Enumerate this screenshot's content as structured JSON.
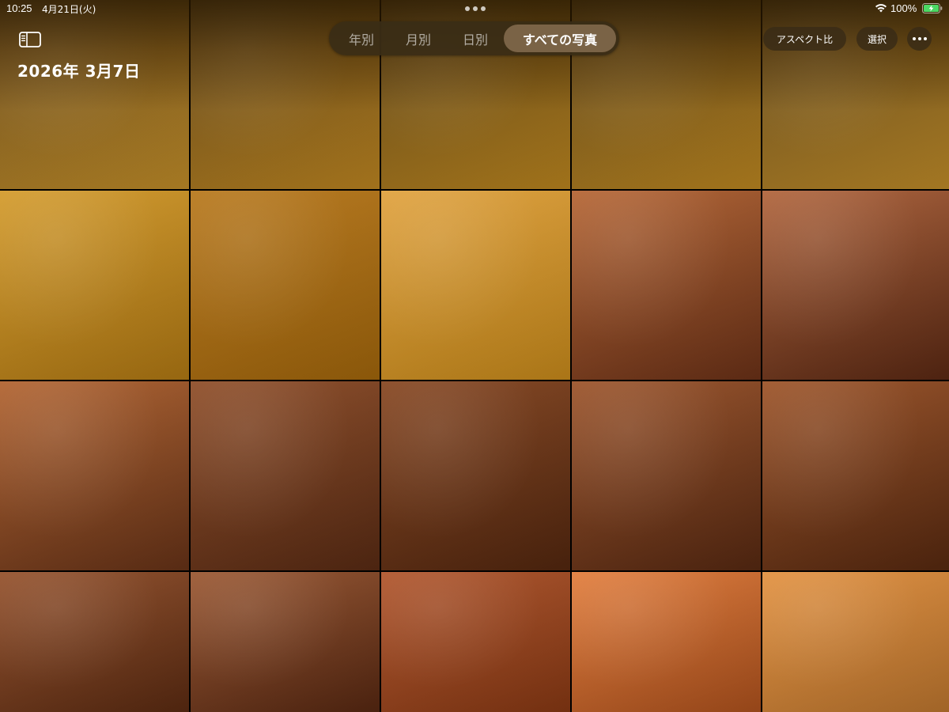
{
  "status_bar": {
    "time": "10:25",
    "date": "4月21日(火)",
    "battery_percent": "100%",
    "battery_level": 1.0,
    "charging": true,
    "wifi_icon": "wifi-icon",
    "battery_color": "#4cd964"
  },
  "header": {
    "sidebar_icon": "sidebar-toggle-icon",
    "title": "2026年 3月7日"
  },
  "view_tabs": {
    "items": [
      {
        "label": "年別",
        "active": false
      },
      {
        "label": "月別",
        "active": false
      },
      {
        "label": "日別",
        "active": false
      },
      {
        "label": "すべての写真",
        "active": true
      }
    ]
  },
  "toolbar": {
    "aspect_label": "アスペクト比",
    "select_label": "選択",
    "more_icon": "ellipsis-icon"
  },
  "grid": {
    "columns": 5,
    "rows": 4,
    "tiles": [
      {
        "from": "#6a4a18",
        "to": "#c8922a"
      },
      {
        "from": "#5e4214",
        "to": "#c48a22"
      },
      {
        "from": "#5a4012",
        "to": "#c28a20"
      },
      {
        "from": "#5c4214",
        "to": "#c48c22"
      },
      {
        "from": "#5e4416",
        "to": "#c6902a"
      },
      {
        "from": "#d39a2a",
        "to": "#b77d14"
      },
      {
        "from": "#b7771a",
        "to": "#a86a0c"
      },
      {
        "from": "#e0a13c",
        "to": "#cf8f1c"
      },
      {
        "from": "#b56432",
        "to": "#6f3318"
      },
      {
        "from": "#b0633a",
        "to": "#5e2a14"
      },
      {
        "from": "#b1622e",
        "to": "#6a3418"
      },
      {
        "from": "#8e4c26",
        "to": "#5c2c14"
      },
      {
        "from": "#86451f",
        "to": "#56280f"
      },
      {
        "from": "#9b5228",
        "to": "#5a2a12"
      },
      {
        "from": "#9c5226",
        "to": "#5a2a10"
      },
      {
        "from": "#94502a",
        "to": "#5e2c12"
      },
      {
        "from": "#9a5630",
        "to": "#5a2912"
      },
      {
        "from": "#b0542a",
        "to": "#8c3a14"
      },
      {
        "from": "#e27c3a",
        "to": "#b4541e"
      },
      {
        "from": "#e2903e",
        "to": "#c47a30"
      }
    ]
  }
}
